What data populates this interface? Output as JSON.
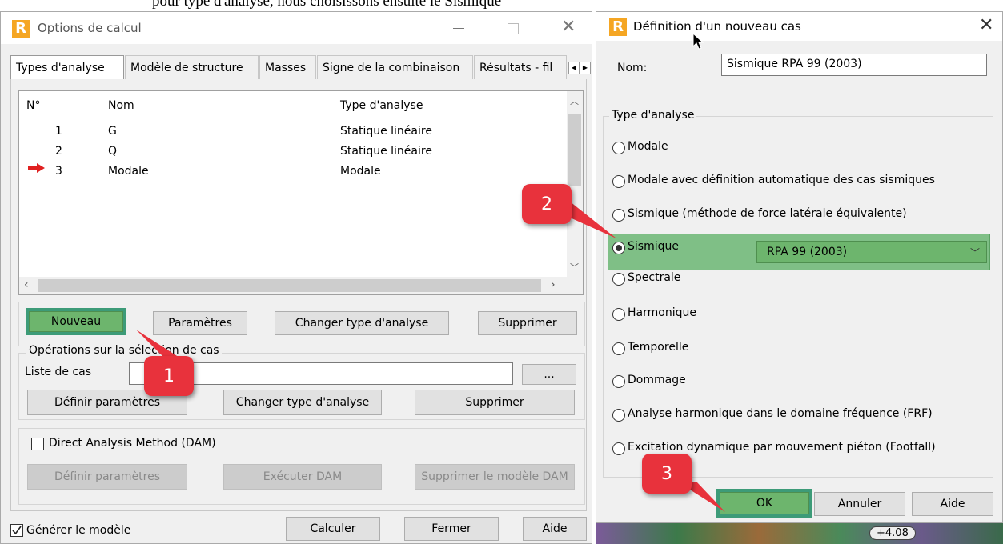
{
  "bg_text": "pour type d'analyse, nous choisissons ensuite le Sismique",
  "options_dialog": {
    "title": "Options de calcul",
    "tabs": [
      "Types d'analyse",
      "Modèle de structure",
      "Masses",
      "Signe de la combinaison",
      "Résultats - fil"
    ],
    "columns": [
      "N°",
      "Nom",
      "Type d'analyse"
    ],
    "rows": [
      {
        "num": "1",
        "name": "G",
        "type": "Statique linéaire"
      },
      {
        "num": "2",
        "name": "Q",
        "type": "Statique linéaire"
      },
      {
        "num": "3",
        "name": "Modale",
        "type": "Modale"
      }
    ],
    "buttons": {
      "nouveau": "Nouveau",
      "parametres": "Paramètres",
      "changer": "Changer type d'analyse",
      "supprimer": "Supprimer"
    },
    "ops_group": "Opérations sur la sélection de cas",
    "liste_label": "Liste de cas",
    "liste_value": "",
    "browse": "...",
    "ops_buttons": {
      "definir": "Définir paramètres",
      "changer": "Changer type d'analyse",
      "supprimer": "Supprimer"
    },
    "dam_label": "Direct Analysis Method (DAM)",
    "dam_buttons": {
      "definir": "Définir paramètres",
      "executer": "Exécuter DAM",
      "supprimer": "Supprimer le modèle DAM"
    },
    "generer_label": "Générer le modèle",
    "footer_buttons": {
      "calculer": "Calculer",
      "fermer": "Fermer",
      "aide": "Aide"
    }
  },
  "new_case_dialog": {
    "title": "Définition d'un nouveau cas",
    "nom_label": "Nom:",
    "nom_value": "Sismique RPA 99 (2003)",
    "group_title": "Type d'analyse",
    "options": [
      "Modale",
      "Modale avec définition automatique des cas sismiques",
      "Sismique (méthode de force latérale équivalente)",
      "Sismique",
      "Spectrale",
      "Harmonique",
      "Temporelle",
      "Dommage",
      "Analyse harmonique dans le domaine fréquence (FRF)",
      "Excitation dynamique par mouvement piéton (Footfall)"
    ],
    "selected_option": "Sismique",
    "code_value": "RPA 99 (2003)",
    "buttons": {
      "ok": "OK",
      "annuler": "Annuler",
      "aide": "Aide"
    }
  },
  "callouts": [
    "1",
    "2",
    "3"
  ],
  "bg_level": "+4.08",
  "colors": {
    "highlight": "#6db56d",
    "callout": "#e8323c",
    "selection_arrow": "#e02020"
  }
}
